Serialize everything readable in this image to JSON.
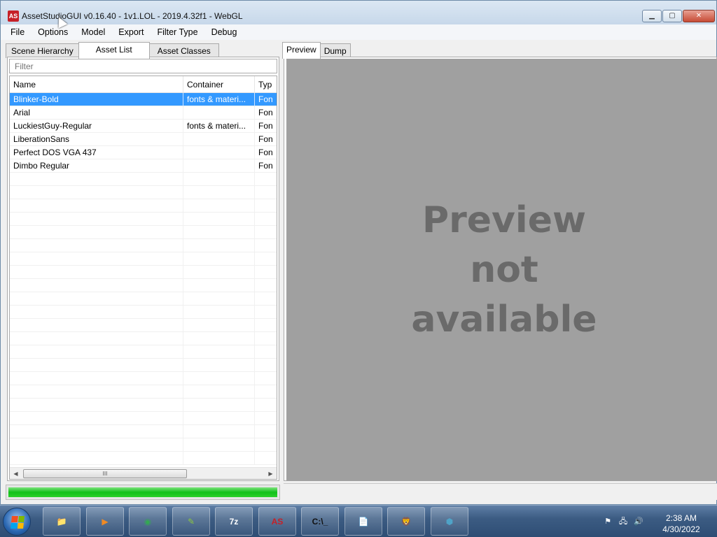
{
  "window": {
    "title": "AssetStudioGUI v0.16.40 - 1v1.LOL - 2019.4.32f1 - WebGL",
    "app_icon_text": "AS",
    "minimize_glyph": "▁",
    "maximize_glyph": "▢",
    "close_glyph": "✕"
  },
  "menu": {
    "items": [
      "File",
      "Options",
      "Model",
      "Export",
      "Filter Type",
      "Debug"
    ]
  },
  "left_panel": {
    "tabs": [
      {
        "label": "Scene Hierarchy",
        "active": false
      },
      {
        "label": "Asset List",
        "active": true
      },
      {
        "label": "Asset Classes",
        "active": false
      }
    ],
    "filter_placeholder": "Filter",
    "columns": [
      "Name",
      "Container",
      "Typ"
    ],
    "rows": [
      {
        "name": "Blinker-Bold",
        "container": "fonts & materi...",
        "type": "Fon",
        "selected": true
      },
      {
        "name": "Arial",
        "container": "",
        "type": "Fon",
        "selected": false
      },
      {
        "name": "LuckiestGuy-Regular",
        "container": "fonts & materi...",
        "type": "Fon",
        "selected": false
      },
      {
        "name": "LiberationSans",
        "container": "",
        "type": "Fon",
        "selected": false
      },
      {
        "name": "Perfect DOS VGA 437",
        "container": "",
        "type": "Fon",
        "selected": false
      },
      {
        "name": "Dimbo Regular",
        "container": "",
        "type": "Fon",
        "selected": false
      }
    ],
    "scroll_left_glyph": "◀",
    "scroll_right_glyph": "▶",
    "scroll_thumb_glyph": "III",
    "progress": 1.0
  },
  "right_panel": {
    "tabs": [
      {
        "label": "Preview",
        "active": true
      },
      {
        "label": "Dump",
        "active": false
      }
    ],
    "preview_message": "Preview\nnot\navailable"
  },
  "taskbar": {
    "apps": [
      {
        "name": "windows-explorer",
        "glyph": "📁",
        "color": "#f2c94c"
      },
      {
        "name": "media-player",
        "glyph": "▶",
        "color": "#f08a24"
      },
      {
        "name": "chrome",
        "glyph": "◉",
        "color": "#34a853"
      },
      {
        "name": "notepad-plus-plus",
        "glyph": "✎",
        "color": "#8cc63f"
      },
      {
        "name": "7zip",
        "glyph": "7z",
        "color": "#ffffff"
      },
      {
        "name": "assetstudio",
        "glyph": "AS",
        "color": "#c62027"
      },
      {
        "name": "command-prompt",
        "glyph": "C:\\_",
        "color": "#111111"
      },
      {
        "name": "notepad",
        "glyph": "📄",
        "color": "#9fd3e8"
      },
      {
        "name": "brave",
        "glyph": "🦁",
        "color": "#fb542b"
      },
      {
        "name": "blocks-app",
        "glyph": "⬢",
        "color": "#4fa3c7"
      }
    ],
    "tray_glyphs": [
      "⚑",
      "🖧",
      "🔊"
    ],
    "time": "2:38 AM",
    "date": "4/30/2022"
  },
  "colors": {
    "selection": "#3399ff",
    "progress": "#11c11a",
    "preview_bg": "#a0a0a0",
    "preview_text": "#6a6a6a"
  }
}
